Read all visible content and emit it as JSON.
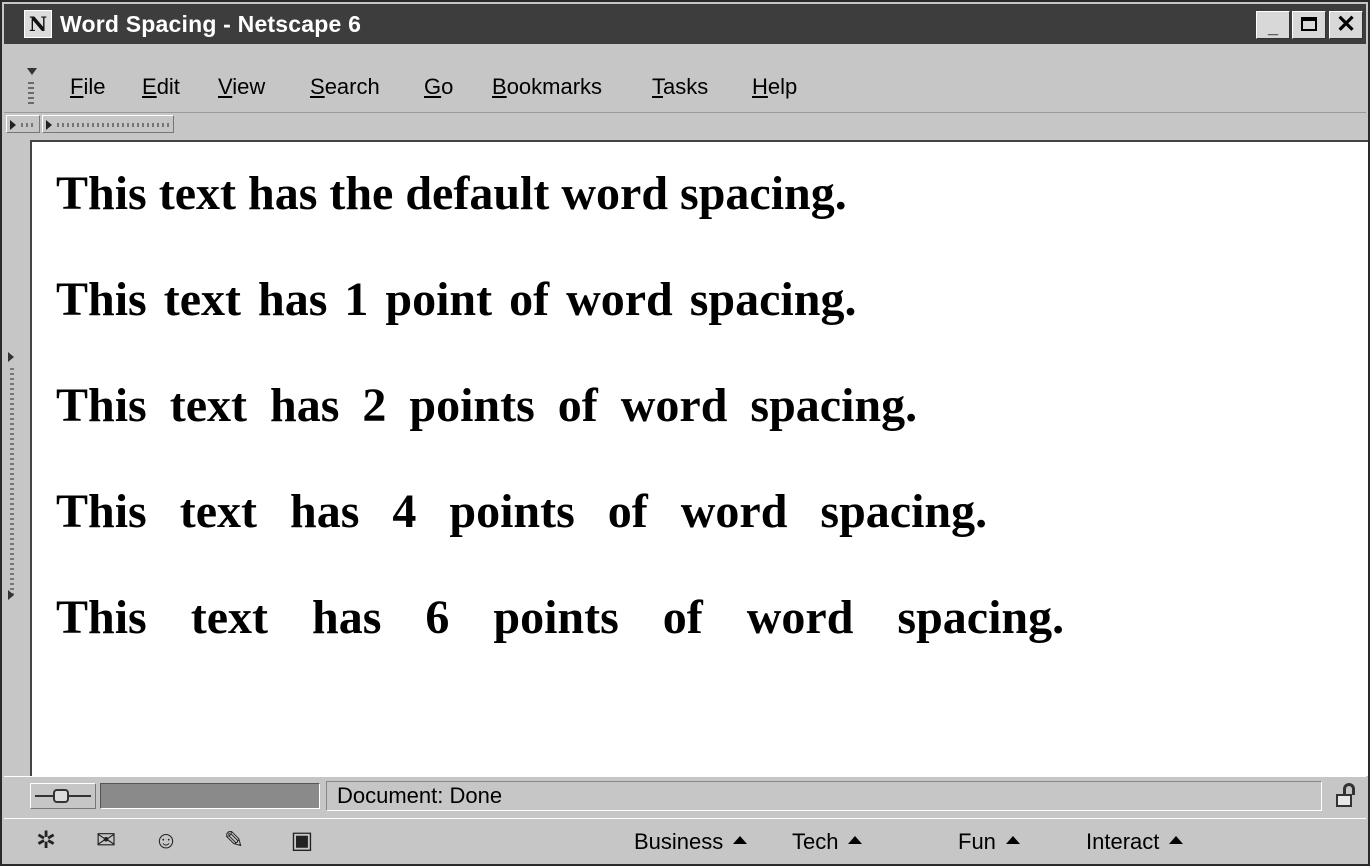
{
  "window": {
    "title": "Word Spacing - Netscape 6",
    "app_icon_letter": "N",
    "controls": {
      "minimize": "_",
      "close": "✕"
    }
  },
  "menu": {
    "items": [
      {
        "accel": "F",
        "rest": "ile"
      },
      {
        "accel": "E",
        "rest": "dit"
      },
      {
        "accel": "V",
        "rest": "iew"
      },
      {
        "accel": "S",
        "rest": "earch"
      },
      {
        "accel": "G",
        "rest": "o"
      },
      {
        "accel": "B",
        "rest": "ookmarks"
      },
      {
        "accel": "T",
        "rest": "asks"
      },
      {
        "accel": "H",
        "rest": "elp"
      }
    ]
  },
  "content": {
    "lines": [
      {
        "text": "This text has the default word spacing.",
        "word_spacing": "default"
      },
      {
        "text": "This text has 1 point of word spacing.",
        "word_spacing": "1pt"
      },
      {
        "text": "This text has 2 points of word spacing.",
        "word_spacing": "2pt"
      },
      {
        "text": "This text has 4 points of word spacing.",
        "word_spacing": "4pt"
      },
      {
        "text": "This text has 6 points of word spacing.",
        "word_spacing": "6pt"
      }
    ]
  },
  "status": {
    "text": "Document: Done",
    "progress": 0
  },
  "component_bar": {
    "icons": [
      "navigator-icon",
      "mail-icon",
      "instant-messenger-icon",
      "composer-icon",
      "address-book-icon"
    ],
    "links": [
      "Business",
      "Tech",
      "Fun",
      "Interact"
    ]
  },
  "colors": {
    "chrome": "#c6c6c6",
    "titlebar": "#3d3d3d",
    "content_bg": "#ffffff",
    "text": "#000000"
  }
}
